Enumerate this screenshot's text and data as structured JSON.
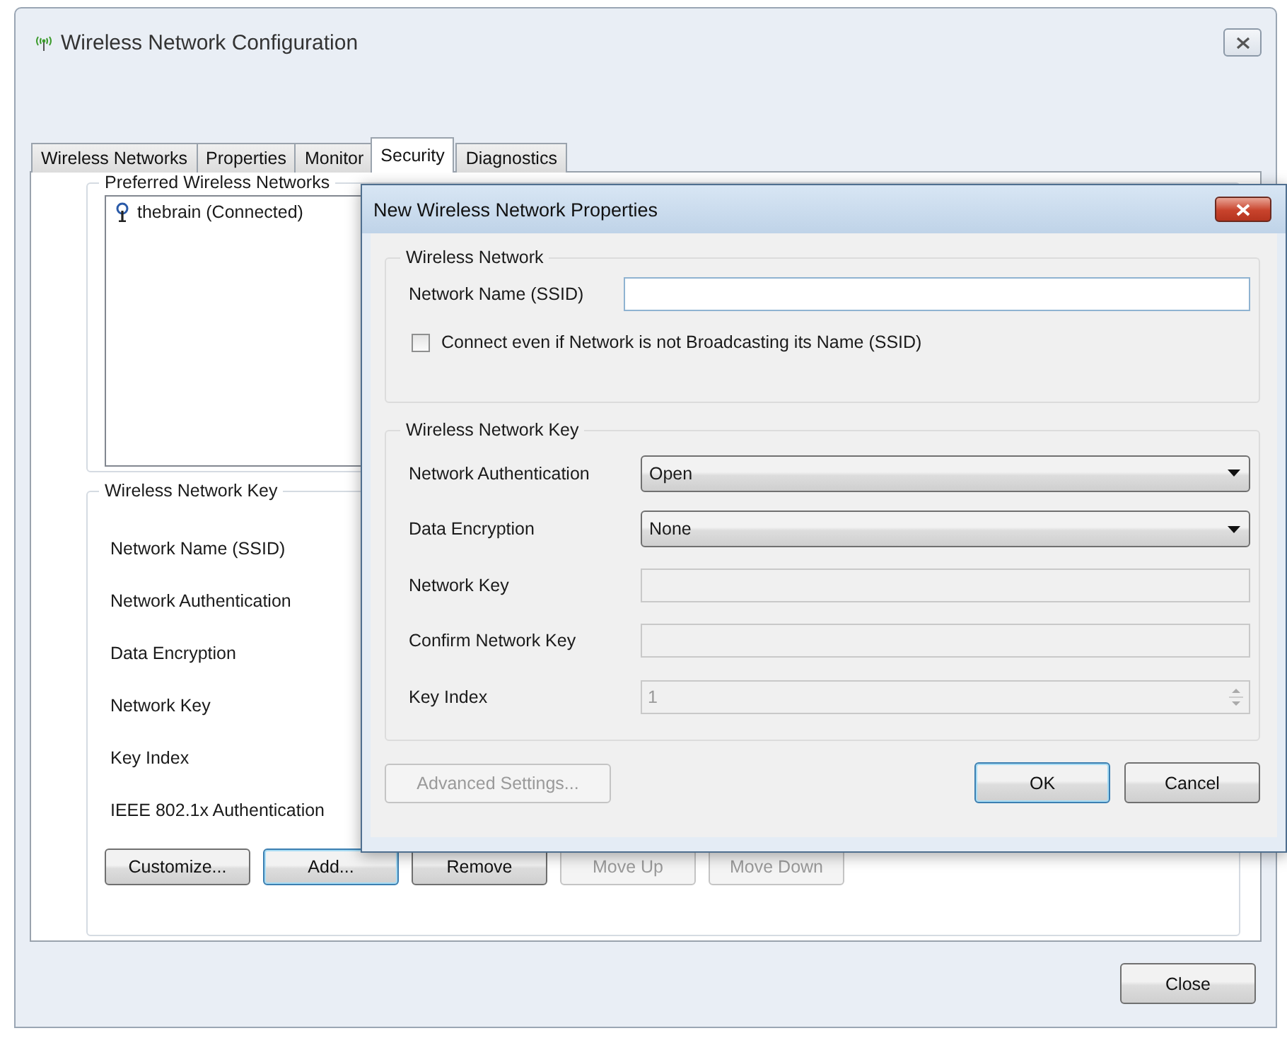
{
  "window": {
    "title": "Wireless Network Configuration"
  },
  "tabs": [
    {
      "label": "Wireless Networks",
      "selected": false
    },
    {
      "label": "Properties",
      "selected": false
    },
    {
      "label": "Monitor",
      "selected": false
    },
    {
      "label": "Security",
      "selected": true
    },
    {
      "label": "Diagnostics",
      "selected": false
    }
  ],
  "preferred_networks": {
    "title": "Preferred Wireless Networks",
    "items": [
      {
        "label": "thebrain (Connected)"
      }
    ]
  },
  "network_key": {
    "title": "Wireless Network Key",
    "labels": [
      "Network Name (SSID)",
      "Network Authentication",
      "Data Encryption",
      "Network Key",
      "Key Index",
      "IEEE 802.1x Authentication"
    ]
  },
  "buttons": [
    {
      "label": "Customize...",
      "disabled": false,
      "default": false
    },
    {
      "label": "Add...",
      "disabled": false,
      "default": true
    },
    {
      "label": "Remove",
      "disabled": false,
      "default": false
    },
    {
      "label": "Move Up",
      "disabled": true,
      "default": false
    },
    {
      "label": "Move Down",
      "disabled": true,
      "default": false
    }
  ],
  "close_button": {
    "label": "Close"
  },
  "dialog": {
    "title": "New Wireless Network Properties",
    "wireless_network": {
      "title": "Wireless Network",
      "ssid_label": "Network Name (SSID)",
      "broadcast_checkbox": {
        "label": "Connect even if Network is not Broadcasting its Name (SSID)",
        "checked": false
      }
    },
    "key": {
      "title": "Wireless Network Key",
      "rows": [
        {
          "label": "Network Authentication",
          "kind": "dropdown",
          "value": "Open",
          "disabled": false
        },
        {
          "label": "Data Encryption",
          "kind": "dropdown",
          "value": "None",
          "disabled": false
        },
        {
          "label": "Network Key",
          "kind": "text",
          "disabled": true
        },
        {
          "label": "Confirm Network Key",
          "kind": "text",
          "disabled": true
        },
        {
          "label": "Key Index",
          "kind": "spinner",
          "value": "1",
          "disabled": true
        }
      ]
    },
    "buttons": [
      {
        "label": "Advanced Settings...",
        "disabled": true,
        "default": false
      },
      {
        "label": "OK",
        "disabled": false,
        "default": true
      },
      {
        "label": "Cancel",
        "disabled": false,
        "default": false
      }
    ]
  }
}
